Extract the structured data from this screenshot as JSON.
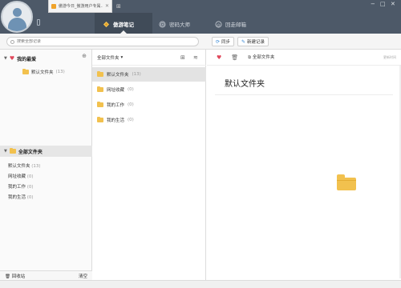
{
  "header": {
    "news_tab": {
      "text": "傲游今日_傲游用户专属…",
      "close": "✕"
    },
    "grid_icon": "⊞",
    "window_controls": [
      "−",
      "□",
      "✕"
    ],
    "nav": [
      {
        "label": "傲游笔记",
        "icon": "note-icon",
        "active": true
      },
      {
        "label": "密码大师",
        "icon": "fingerprint-icon",
        "active": false
      },
      {
        "label": "回走邮箱",
        "icon": "mail-icon",
        "active": false
      }
    ]
  },
  "toolbar": {
    "search_placeholder": "搜索全部记录",
    "sync_label": "同步",
    "new_note_label": "新建记录"
  },
  "sidebar": {
    "favorites_label": "我的最爱",
    "favorite_item": {
      "label": "默认文件夹",
      "count": "(13)"
    },
    "all_folders_label": "全部文件夹",
    "folders": [
      {
        "label": "默认文件夹",
        "count": "(13)"
      },
      {
        "label": "网址收藏",
        "count": "(0)"
      },
      {
        "label": "我的工作",
        "count": "(0)"
      },
      {
        "label": "我的生活",
        "count": "(0)"
      }
    ],
    "recycle_label": "回收站",
    "empty_label": "清空"
  },
  "middle": {
    "header_label": "全部文件夹",
    "folders": [
      {
        "label": "默认文件夹",
        "count": "(13)",
        "selected": true
      },
      {
        "label": "网址收藏",
        "count": "(0)",
        "selected": false
      },
      {
        "label": "我的工作",
        "count": "(0)",
        "selected": false
      },
      {
        "label": "我的生活",
        "count": "(0)",
        "selected": false
      }
    ]
  },
  "note": {
    "folder_button_label": "全部文件夹",
    "date_text": "更新时间",
    "title": "默认文件夹"
  },
  "colors": {
    "header_bg": "#4d5968",
    "accent_blue": "#3a8ad6",
    "folder_yellow": "#f2c14e",
    "heart_red": "#e0485b"
  }
}
